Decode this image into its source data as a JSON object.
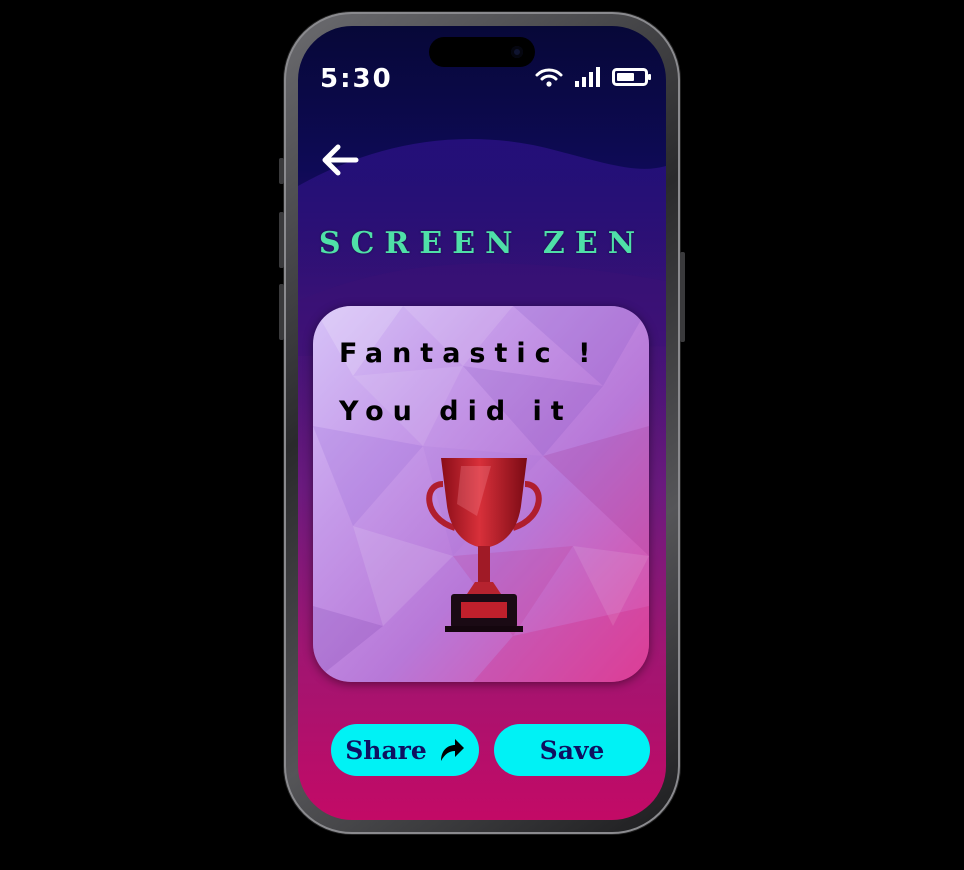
{
  "status_bar": {
    "time": "5:30"
  },
  "header": {
    "title": "SCREEN ZEN"
  },
  "card": {
    "line1": "Fantastic !",
    "line2": "You did it"
  },
  "actions": {
    "share_label": "Share",
    "save_label": "Save"
  },
  "colors": {
    "title": "#4fe0a8",
    "button_bg": "#00f2f5",
    "button_text": "#0f1060",
    "trophy": "#c01e2a"
  },
  "icons": [
    "wifi-icon",
    "signal-icon",
    "battery-icon",
    "back-arrow-icon",
    "share-arrow-icon",
    "trophy-icon"
  ]
}
